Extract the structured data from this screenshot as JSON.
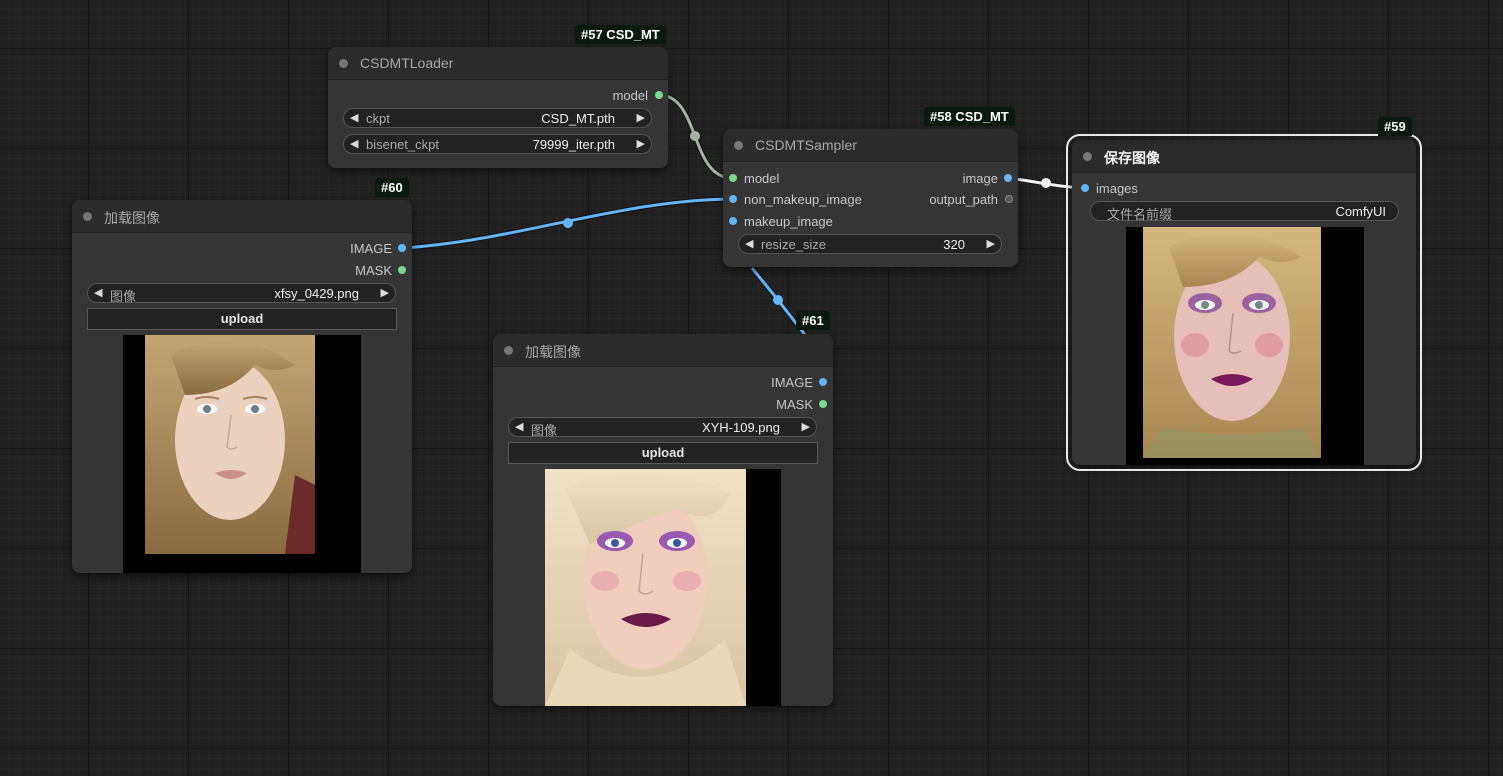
{
  "nodes": {
    "loader": {
      "badge": "#57 CSD_MT",
      "title": "CSDMTLoader",
      "output_model": "model",
      "ckpt_name": "ckpt",
      "ckpt_value": "CSD_MT.pth",
      "bisenet_name": "bisenet_ckpt",
      "bisenet_value": "79999_iter.pth"
    },
    "sampler": {
      "badge": "#58 CSD_MT",
      "title": "CSDMTSampler",
      "input_model": "model",
      "input_non_makeup": "non_makeup_image",
      "input_makeup": "makeup_image",
      "output_image": "image",
      "output_path": "output_path",
      "resize_name": "resize_size",
      "resize_value": "320"
    },
    "load_a": {
      "badge": "#60",
      "title": "加载图像",
      "output_image": "IMAGE",
      "output_mask": "MASK",
      "image_name": "图像",
      "image_value": "xfsy_0429.png",
      "upload_label": "upload"
    },
    "load_b": {
      "badge": "#61",
      "title": "加载图像",
      "output_image": "IMAGE",
      "output_mask": "MASK",
      "image_name": "图像",
      "image_value": "XYH-109.png",
      "upload_label": "upload"
    },
    "save": {
      "badge": "#59",
      "title": "保存图像",
      "input_images": "images",
      "prefix_name": "文件名前缀",
      "prefix_value": "ComfyUI"
    }
  },
  "colors": {
    "canvas_bg": "#202020",
    "node_bg": "#353535",
    "image_link": "#64b5f6",
    "model_link": "#a3b5a0",
    "badge_bg": "#0a1a0e"
  },
  "icons": {
    "decrement": "left-triangle-icon",
    "increment": "right-triangle-icon"
  }
}
